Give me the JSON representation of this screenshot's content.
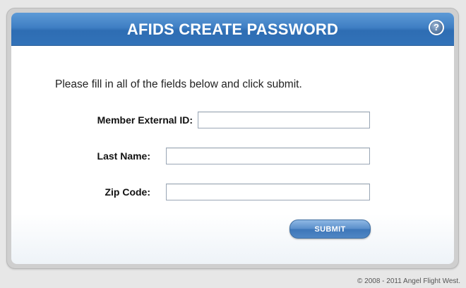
{
  "header": {
    "title": "AFIDS CREATE PASSWORD",
    "help_icon_glyph": "?",
    "help_icon_name": "help-icon"
  },
  "form": {
    "instructions": "Please fill in all of the fields below and click submit.",
    "fields": [
      {
        "label": "Member External ID:",
        "value": "",
        "placeholder": ""
      },
      {
        "label": "Last Name:",
        "value": "",
        "placeholder": ""
      },
      {
        "label": "Zip Code:",
        "value": "",
        "placeholder": ""
      }
    ],
    "submit_label": "SUBMIT"
  },
  "footer": {
    "copyright": "© 2008 - 2011 Angel Flight West."
  },
  "colors": {
    "header_blue": "#3f7fc4",
    "button_blue": "#5a8fcb",
    "panel_gray": "#cfcfcf",
    "page_background": "#e7e7e7"
  }
}
